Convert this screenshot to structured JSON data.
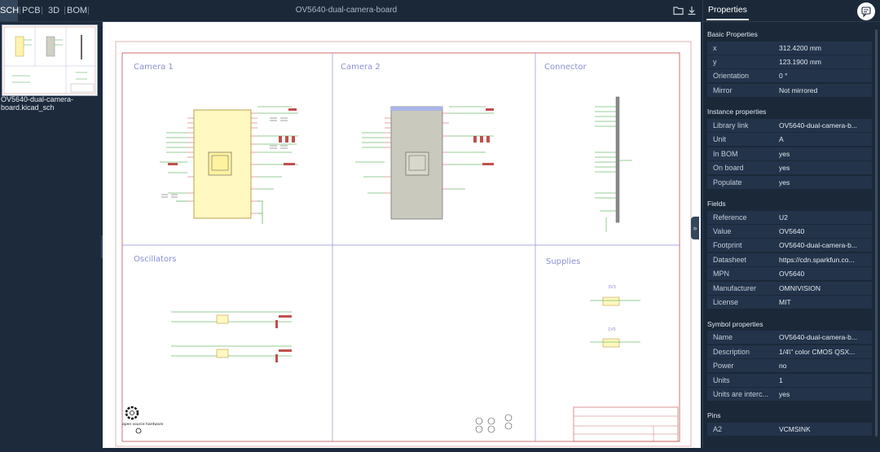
{
  "tabs": [
    {
      "label": "SCH",
      "active": true
    },
    {
      "label": "PCB",
      "active": false
    },
    {
      "label": "3D",
      "active": false
    },
    {
      "label": "BOM",
      "active": false
    }
  ],
  "document_title": "OV5640-dual-camera-board",
  "toolbar_icons": [
    "folder-open-icon",
    "download-icon"
  ],
  "thumbnails": [
    {
      "label": "OV5640-dual-camera-board.kicad_sch",
      "selected": true
    }
  ],
  "schematic": {
    "sections": {
      "camera1": "Camera 1",
      "camera2": "Camera 2",
      "connector": "Connector",
      "oscillators": "Oscillators",
      "supplies": "Supplies"
    },
    "supply_labels": [
      "3V3",
      "1V5"
    ],
    "logo_label": "open source hardware"
  },
  "properties": {
    "tab_label": "Properties",
    "chat_icon": "chat-icon",
    "groups": [
      {
        "title": "Basic Properties",
        "rows": [
          {
            "key": "x",
            "value": "312.4200 mm"
          },
          {
            "key": "y",
            "value": "123.1900 mm"
          },
          {
            "key": "Orientation",
            "value": "0 °"
          },
          {
            "key": "Mirror",
            "value": "Not mirrored"
          }
        ]
      },
      {
        "title": "Instance properties",
        "rows": [
          {
            "key": "Library link",
            "value": "OV5640-dual-camera-b..."
          },
          {
            "key": "Unit",
            "value": "A"
          },
          {
            "key": "In BOM",
            "value": "yes"
          },
          {
            "key": "On board",
            "value": "yes"
          },
          {
            "key": "Populate",
            "value": "yes"
          }
        ]
      },
      {
        "title": "Fields",
        "rows": [
          {
            "key": "Reference",
            "value": "U2"
          },
          {
            "key": "Value",
            "value": "OV5640"
          },
          {
            "key": "Footprint",
            "value": "OV5640-dual-camera-b..."
          },
          {
            "key": "Datasheet",
            "value": "https://cdn.sparkfun.co..."
          },
          {
            "key": "MPN",
            "value": "OV5640"
          },
          {
            "key": "Manufacturer",
            "value": "OMNIVISION"
          },
          {
            "key": "License",
            "value": "MIT"
          }
        ]
      },
      {
        "title": "Symbol properties",
        "rows": [
          {
            "key": "Name",
            "value": "OV5640-dual-camera-b..."
          },
          {
            "key": "Description",
            "value": "1/4\\\" color CMOS QSX..."
          },
          {
            "key": "Power",
            "value": "no"
          },
          {
            "key": "Units",
            "value": "1"
          },
          {
            "key": "Units are interc...",
            "value": "yes"
          }
        ]
      },
      {
        "title": "Pins",
        "rows": [
          {
            "key": "A2",
            "value": "VCMSINK"
          }
        ]
      }
    ]
  },
  "colors": {
    "panel_bg": "#1b2838",
    "row_bg": "#23334a",
    "sheet_border": "#c0504d",
    "sheet_grid": "#8b8fd6",
    "component_fill_yellow": "#fff8c0",
    "component_fill_gray": "#c9c9bd",
    "wire_green": "#2f9e2f"
  }
}
